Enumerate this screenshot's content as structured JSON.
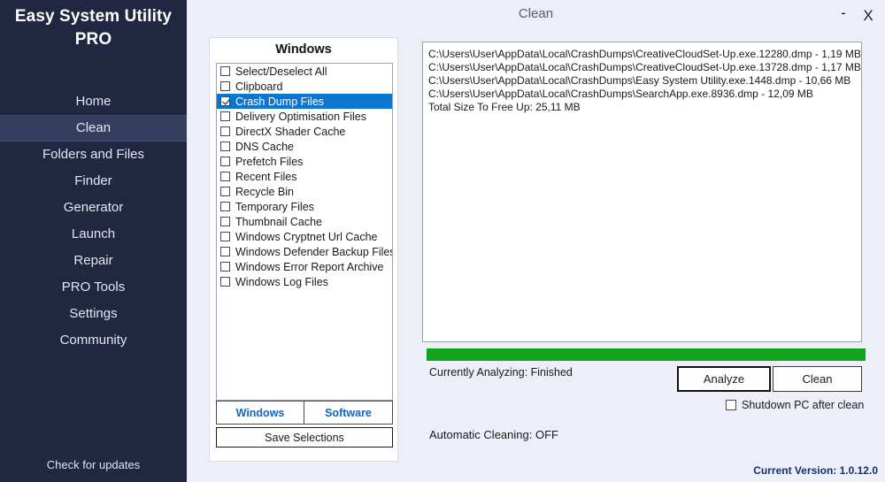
{
  "app": {
    "brand_line1": "Easy System Utility",
    "brand_line2": "PRO",
    "check_updates": "Check for updates",
    "version": "Current Version: 1.0.12.0"
  },
  "titlebar": {
    "title": "Clean",
    "minimize": "-",
    "close": "X"
  },
  "sidebar": {
    "items": [
      {
        "label": "Home",
        "active": false
      },
      {
        "label": "Clean",
        "active": true
      },
      {
        "label": "Folders and Files",
        "active": false
      },
      {
        "label": "Finder",
        "active": false
      },
      {
        "label": "Generator",
        "active": false
      },
      {
        "label": "Launch",
        "active": false
      },
      {
        "label": "Repair",
        "active": false
      },
      {
        "label": "PRO Tools",
        "active": false
      },
      {
        "label": "Settings",
        "active": false
      },
      {
        "label": "Community",
        "active": false
      }
    ]
  },
  "left_panel": {
    "title": "Windows",
    "items": [
      {
        "label": "Select/Deselect All",
        "checked": false,
        "selected": false
      },
      {
        "label": "Clipboard",
        "checked": false,
        "selected": false
      },
      {
        "label": "Crash Dump Files",
        "checked": true,
        "selected": true
      },
      {
        "label": "Delivery Optimisation Files",
        "checked": false,
        "selected": false
      },
      {
        "label": "DirectX Shader Cache",
        "checked": false,
        "selected": false
      },
      {
        "label": "DNS Cache",
        "checked": false,
        "selected": false
      },
      {
        "label": "Prefetch Files",
        "checked": false,
        "selected": false
      },
      {
        "label": "Recent Files",
        "checked": false,
        "selected": false
      },
      {
        "label": "Recycle Bin",
        "checked": false,
        "selected": false
      },
      {
        "label": "Temporary Files",
        "checked": false,
        "selected": false
      },
      {
        "label": "Thumbnail Cache",
        "checked": false,
        "selected": false
      },
      {
        "label": "Windows Cryptnet Url Cache",
        "checked": false,
        "selected": false
      },
      {
        "label": "Windows Defender Backup Files",
        "checked": false,
        "selected": false
      },
      {
        "label": "Windows Error Report Archive",
        "checked": false,
        "selected": false
      },
      {
        "label": "Windows Log Files",
        "checked": false,
        "selected": false
      }
    ],
    "tabs": [
      {
        "label": "Windows"
      },
      {
        "label": "Software"
      }
    ],
    "save_selections": "Save Selections"
  },
  "right_panel": {
    "log_lines": [
      "C:\\Users\\User\\AppData\\Local\\CrashDumps\\CreativeCloudSet-Up.exe.12280.dmp - 1,19 MB",
      "C:\\Users\\User\\AppData\\Local\\CrashDumps\\CreativeCloudSet-Up.exe.13728.dmp - 1,17 MB",
      "C:\\Users\\User\\AppData\\Local\\CrashDumps\\Easy System Utility.exe.1448.dmp - 10,66 MB",
      "C:\\Users\\User\\AppData\\Local\\CrashDumps\\SearchApp.exe.8936.dmp - 12,09 MB",
      "Total Size To Free Up: 25,11 MB"
    ],
    "progress_percent": 100,
    "progress_color": "#11a41e",
    "status": "Currently Analyzing: Finished",
    "analyze_button": "Analyze",
    "clean_button": "Clean",
    "shutdown_label": "Shutdown PC after clean",
    "shutdown_checked": false,
    "automatic_cleaning": "Automatic Cleaning: OFF"
  },
  "colors": {
    "sidebar_bg": "#222741",
    "sidebar_active": "#353e5e",
    "window_bg": "#eceff8",
    "selection_blue": "#0b76d0",
    "tab_link": "#1565c0",
    "progress_green": "#11a41e",
    "version_text": "#16306b"
  }
}
